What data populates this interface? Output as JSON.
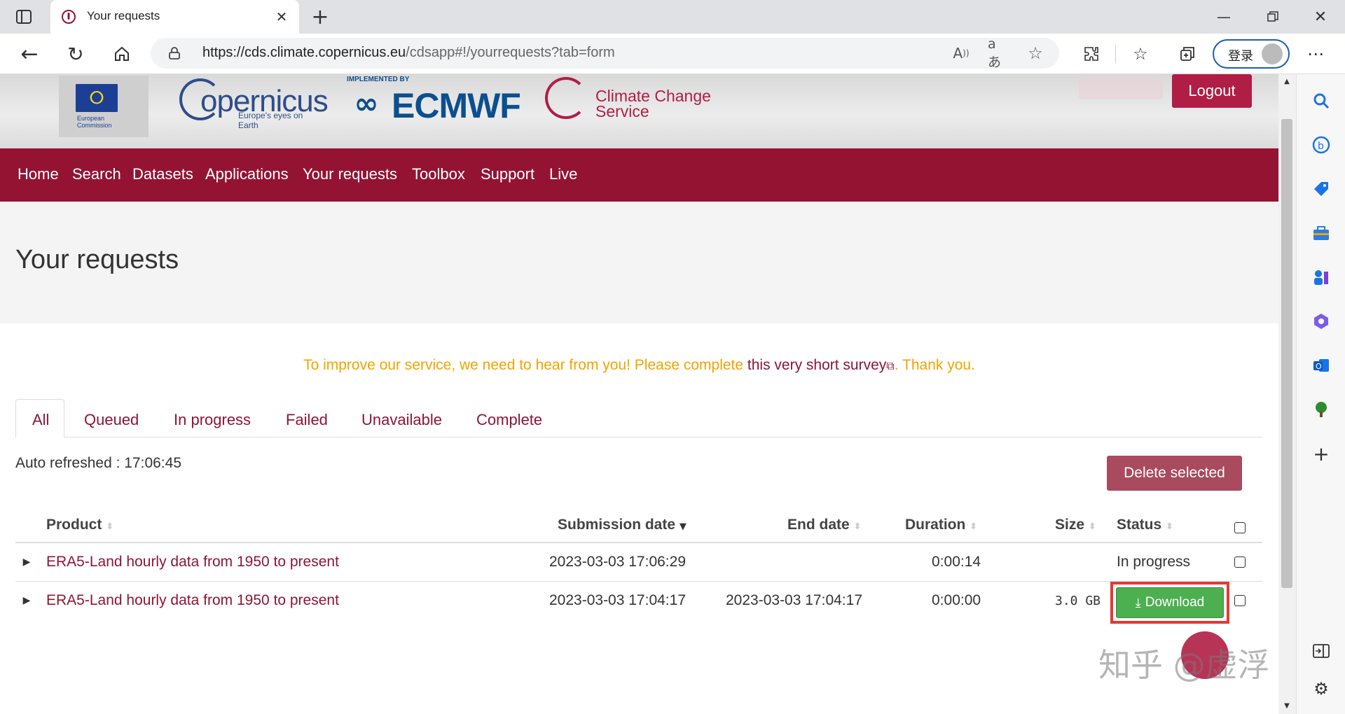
{
  "browser": {
    "tab_title": "Your requests",
    "url_host": "https://cds.climate.copernicus.eu",
    "url_path": "/cdsapp#!/yourrequests?tab=form",
    "profile_label": "登录"
  },
  "header": {
    "eu_label": "European Commission",
    "copernicus_name": "opernicus",
    "copernicus_tagline": "Europe's eyes on Earth",
    "ecmwf_implemented": "IMPLEMENTED BY",
    "ecmwf_name": "ECMWF",
    "ccs_line1": "Climate Change",
    "ccs_line2": "Service",
    "logout_label": "Logout"
  },
  "nav": [
    "Home",
    "Search",
    "Datasets",
    "Applications",
    "Your requests",
    "Toolbox",
    "Support",
    "Live"
  ],
  "page_title": "Your requests",
  "survey": {
    "lead": "To improve our service, we need to hear from you! Please complete ",
    "link": "this very short survey",
    "tail": ". Thank you."
  },
  "filter_tabs": [
    "All",
    "Queued",
    "In progress",
    "Failed",
    "Unavailable",
    "Complete"
  ],
  "auto_refreshed": "Auto refreshed : 17:06:45",
  "delete_label": "Delete selected",
  "table": {
    "headers": {
      "product": "Product",
      "submission": "Submission date",
      "end": "End date",
      "duration": "Duration",
      "size": "Size",
      "status": "Status"
    },
    "rows": [
      {
        "product": "ERA5-Land hourly data from 1950 to present",
        "submission": "2023-03-03 17:06:29",
        "end": "",
        "duration": "0:00:14",
        "size": "",
        "status": "In progress"
      },
      {
        "product": "ERA5-Land hourly data from 1950 to present",
        "submission": "2023-03-03 17:04:17",
        "end": "2023-03-03 17:04:17",
        "duration": "0:00:00",
        "size": "3.0 GB",
        "status": "Download"
      }
    ]
  },
  "watermark": "知乎 @虚浮",
  "colors": {
    "brand": "#941333",
    "delete_button": "#b01e45",
    "download_button": "#4caf50",
    "survey_text": "#f0a500",
    "highlight_border": "#e53935"
  }
}
